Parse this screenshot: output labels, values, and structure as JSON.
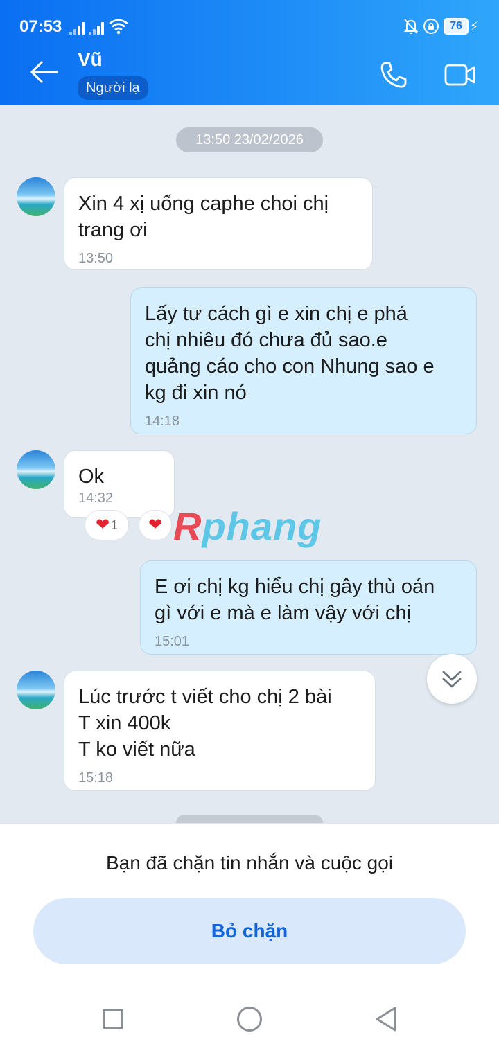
{
  "status_bar": {
    "time": "07:53",
    "battery": "76",
    "icons": [
      "signal-icon",
      "signal-icon",
      "wifi-icon",
      "bell-muted-icon",
      "lock-rotation-icon",
      "battery-icon",
      "charging-icon"
    ]
  },
  "header": {
    "contact_name": "Vũ",
    "badge": "Người lạ",
    "icons": [
      "back-arrow-icon",
      "phone-icon",
      "video-call-icon"
    ]
  },
  "chat": {
    "date_separator": "13:50 23/02/2026",
    "messages": [
      {
        "direction": "in",
        "text": "Xin 4 xị uống caphe choi chị\ntrang ơi",
        "time": "13:50"
      },
      {
        "direction": "out",
        "text": "Lấy tư cách gì e xin chị e phá\nchị nhiêu đó chưa đủ sao.e\nquảng cáo cho con Nhung sao e\nkg đi xin nó",
        "time": "14:18"
      },
      {
        "direction": "in",
        "text": "Ok",
        "time": "14:32",
        "reaction_count": "1"
      },
      {
        "direction": "out",
        "text": "E ơi chị kg hiểu chị gây thù oán\ngì với e mà e làm vậy với chị",
        "time": "15:01"
      },
      {
        "direction": "in",
        "text": "Lúc trước t viết cho chị 2 bài\nT xin 400k\nT ko viết nữa",
        "time": "15:18"
      }
    ],
    "watermark": {
      "part1": "R",
      "part2": "phang"
    }
  },
  "blocked_panel": {
    "message": "Bạn đã chặn tin nhắn và cuộc gọi",
    "unblock_label": "Bỏ chặn"
  },
  "colors": {
    "header_start": "#0a6ff2",
    "header_end": "#2fa6fb",
    "incoming_bubble": "#ffffff",
    "outgoing_bubble": "#d6efff",
    "chat_background": "#e2e9f1",
    "unblock_text": "#1466d8"
  }
}
